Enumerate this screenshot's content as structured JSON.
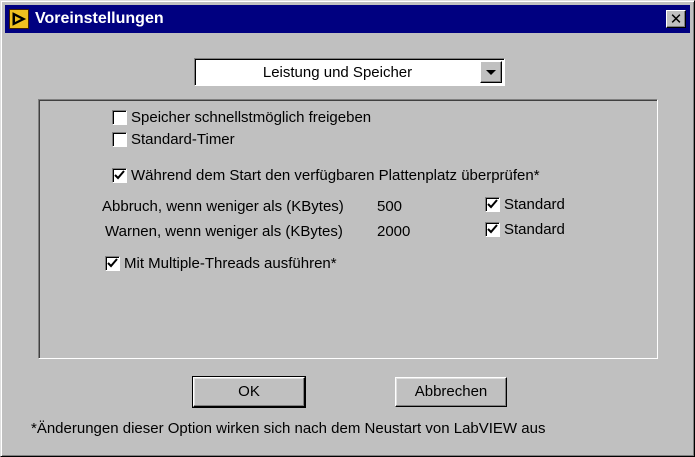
{
  "window": {
    "title": "Voreinstellungen",
    "close_glyph": "✕"
  },
  "category_dropdown": {
    "selected": "Leistung und Speicher"
  },
  "options": {
    "free_memory": {
      "label": "Speicher schnellstmöglich freigeben",
      "checked": false
    },
    "standard_timer": {
      "label": "Standard-Timer",
      "checked": false
    },
    "check_disk_space": {
      "label": "Während dem Start den verfügbaren Plattenplatz überprüfen*",
      "checked": true
    },
    "abort_threshold": {
      "label": "Abbruch, wenn weniger als (KBytes)",
      "value": "500",
      "standard_label": "Standard",
      "standard_checked": true
    },
    "warn_threshold": {
      "label": "Warnen, wenn weniger als (KBytes)",
      "value": "2000",
      "standard_label": "Standard",
      "standard_checked": true
    },
    "multithreading": {
      "label": "Mit Multiple-Threads ausführen*",
      "checked": true
    }
  },
  "buttons": {
    "ok_label": "OK",
    "cancel_label": "Abbrechen"
  },
  "footer_note": "*Änderungen dieser Option wirken sich nach dem Neustart von LabVIEW aus"
}
